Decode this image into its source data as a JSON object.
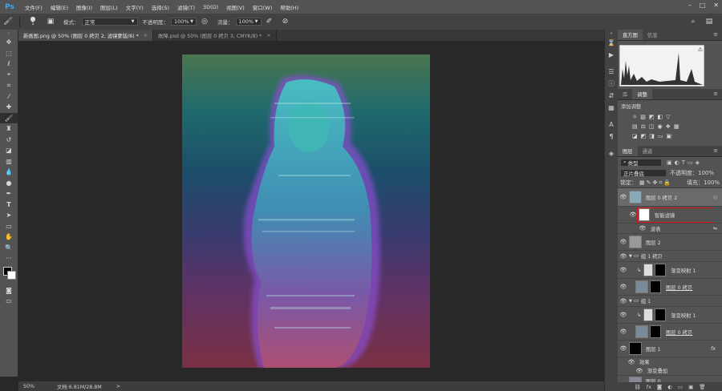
{
  "app": {
    "logo": "Ps"
  },
  "menu": [
    "文件(F)",
    "编辑(E)",
    "图像(I)",
    "图层(L)",
    "文字(Y)",
    "选择(S)",
    "滤镜(T)",
    "3D(D)",
    "视图(V)",
    "窗口(W)",
    "帮助(H)"
  ],
  "options": {
    "brush_size": "1",
    "mode_label": "模式：",
    "mode_value": "正常",
    "opacity_label": "不透明度：",
    "opacity_value": "100%",
    "flow_label": "流量：",
    "flow_value": "100%"
  },
  "tabs": [
    {
      "label": "新画图.png @ 50% (图层 0 拷贝 2, 滤镜蒙版/8) *",
      "close": "×"
    },
    {
      "label": "故障.psd @ 50% (图层 0 拷贝 3, CMYK/8) *",
      "close": "×"
    }
  ],
  "status": {
    "zoom": "50%",
    "doc": "文档:6.81M/28.8M",
    "arrow": ">"
  },
  "panels": {
    "top_tabs": [
      "直方图",
      "信息"
    ],
    "adj_tabs": [
      "库",
      "调整"
    ],
    "adj_title": "添加调整",
    "layers_tabs": [
      "图层",
      "通道"
    ],
    "filter_kind": "类型",
    "blend_mode": "正片叠底",
    "opacity_label": "不透明度：",
    "opacity_value": "100%",
    "lock_label": "锁定：",
    "fill_label": "填充：",
    "fill_value": "100%",
    "layers": [
      {
        "name": "图层 0 拷贝 2"
      },
      {
        "name": "智能滤镜"
      },
      {
        "name": "波表"
      },
      {
        "name": "图层 2"
      },
      {
        "name": "组 1 拷贝"
      },
      {
        "name": "渐变映射 1"
      },
      {
        "name": "图层 0 拷贝"
      },
      {
        "name": "组 1"
      },
      {
        "name": "渐变映射 1"
      },
      {
        "name": "图层 0 拷贝"
      },
      {
        "name": "图层 1"
      },
      {
        "name": "效果"
      },
      {
        "name": "渐变叠加"
      },
      {
        "name": "图层 0"
      }
    ],
    "fx": "fx"
  }
}
